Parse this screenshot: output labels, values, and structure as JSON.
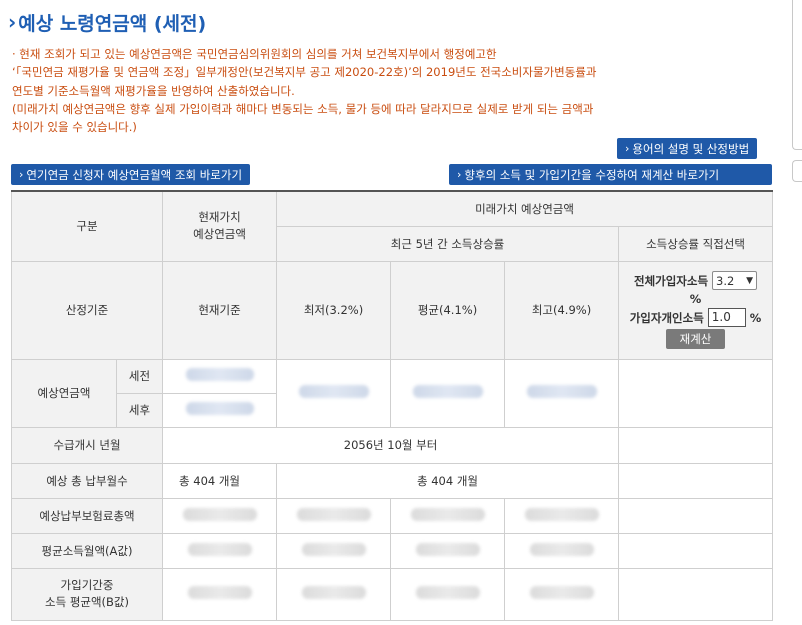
{
  "page": {
    "title": "예상 노령연금액 (세전)"
  },
  "notice": [
    "· 현재 조회가 되고 있는 예상연금액은 국민연금심의위원회의 심의를 거쳐 보건복지부에서 행정예고한",
    "  ‘「국민연금 재평가율 및 연금액 조정」일부개정안(보건복지부 공고 제2020-22호)’의 2019년도 전국소비자물가변동률과",
    "  연도별 기준소득월액 재평가율을 반영하여 산출하였습니다.",
    "  (미래가치 예상연금액은 향후 실제 가입이력과 해마다 변동되는 소득, 물가 등에 따라 달라지므로 실제로 받게 되는 금액과",
    "  차이가 있을 수 있습니다.)"
  ],
  "buttons": {
    "terms": "용어의 설명 및 산정방법",
    "lookup": "연기연금 신청자 예상연금월액 조회 바로가기",
    "recalc_link": "향후의 소득 및 가입기간을 수정하여 재계산 바로가기"
  },
  "table": {
    "category": "구분",
    "present_value": "현재가치\n예상연금액",
    "future_value": "미래가치 예상연금액",
    "recent5": "최근 5년 간 소득상승률",
    "direct_select": "소득상승률 직접선택",
    "basis_label": "산정기준",
    "current_basis": "현재기준",
    "low": "최저(3.2%)",
    "avg": "평균(4.1%)",
    "high": "최고(4.9%)",
    "overall_income_label": "전체가입자소득",
    "overall_income_value": "3.2",
    "percent_sign": "%",
    "personal_income_label": "가입자개인소득",
    "personal_income_value": "1.0",
    "recalc_button": "재계산",
    "expected_label": "예상연금액",
    "pretax": "세전",
    "aftertax": "세후",
    "start_label": "수급개시 년월",
    "start_value": "2056년 10월 부터",
    "months_label": "예상 총 납부월수",
    "months_current": "총 404 개월",
    "months_future": "총 404 개월",
    "premium_label": "예상납부보험료총액",
    "avg_income_label": "평균소득월액(A값)",
    "period_avg_label": "가입기간중\n소득 평균액(B값)"
  }
}
